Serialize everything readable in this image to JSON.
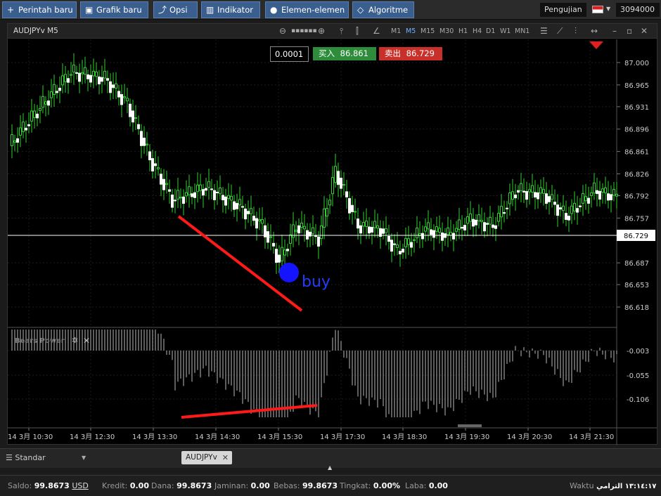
{
  "toolbar": {
    "new_order": "Perintah baru",
    "new_chart": "Grafik baru",
    "options": "Opsi",
    "indicators": "Indikator",
    "elements": "Elemen-elemen",
    "algorithm": "Algoritme",
    "mode": "Pengujian",
    "account": "3094000"
  },
  "chart_window": {
    "symbol": "AUDJPYv M5",
    "timeframes": [
      "M1",
      "M5",
      "M15",
      "M30",
      "H1",
      "H4",
      "D1",
      "W1",
      "MN1"
    ],
    "active_timeframe": "M5"
  },
  "trade": {
    "volume": "0.0001",
    "buy_label": "买入",
    "buy_price": "86.861",
    "sell_label": "卖出",
    "sell_price": "86.729"
  },
  "chart": {
    "price_ticks": [
      "87.000",
      "86.965",
      "86.931",
      "86.896",
      "86.861",
      "86.826",
      "86.792",
      "86.757",
      "86.687",
      "86.653",
      "86.618"
    ],
    "current_price": "86.729",
    "buy_annotation": "buy",
    "indicator_name": "Bears Power",
    "indicator_ticks": [
      "-0.003",
      "-0.055",
      "-0.106"
    ],
    "time_labels": [
      "14 3月 10:30",
      "14 3月 12:30",
      "14 3月 13:30",
      "14 3月 14:30",
      "14 3月 15:30",
      "14 3月 17:30",
      "14 3月 18:30",
      "14 3月 19:30",
      "14 3月 20:30",
      "14 3月 21:30"
    ],
    "colors": {
      "up": "#2fd12f",
      "down": "#ffffff",
      "trendline": "#ff1a1a",
      "signal": "#1414ff",
      "indicator": "#bbbbbb"
    }
  },
  "tabs": {
    "layout": "Standar",
    "document": "AUDJPYv"
  },
  "status": {
    "balance_label": "Saldo:",
    "balance": "99.8673",
    "currency": "USD",
    "credit_label": "Kredit:",
    "credit": "0.00",
    "equity_label": "Dana:",
    "equity": "99.8673",
    "margin_label": "Jaminan:",
    "margin": "0.00",
    "free_label": "Bebas:",
    "free": "99.8673",
    "level_label": "Tingkat:",
    "level": "0.00%",
    "profit_label": "Laba:",
    "profit": "0.00",
    "time_label": "Waktu",
    "time": "١٣:١٤:١٧ الترامي"
  }
}
